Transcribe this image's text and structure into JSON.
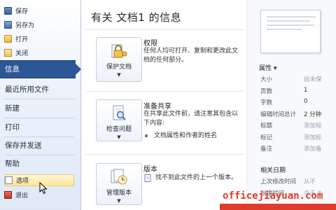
{
  "file_menu": {
    "items": [
      {
        "label": "保存",
        "icon": "save-icon"
      },
      {
        "label": "另存为",
        "icon": "save-as-icon"
      },
      {
        "label": "打开",
        "icon": "folder-open-icon"
      },
      {
        "label": "关闭",
        "icon": "close-document-icon"
      }
    ]
  },
  "nav": {
    "active": "信息",
    "items": [
      "最近所用文件",
      "新建",
      "打印",
      "保存并发送",
      "帮助"
    ]
  },
  "bottom_menu": {
    "options_label": "选项",
    "exit_label": "退出"
  },
  "page": {
    "title": "有关 文档1 的信息"
  },
  "sections": [
    {
      "button": "保护文档",
      "icon": "lock-key-icon",
      "title": "权限",
      "desc": "任何人均可打开、复制和更改此文档的任何部分。"
    },
    {
      "button": "检查问题",
      "icon": "inspect-document-icon",
      "title": "准备共享",
      "desc": "在共享此文件前，请注意其包含以下内容:",
      "bullets": [
        "文档属性和作者的姓名"
      ]
    },
    {
      "button": "管理版本",
      "icon": "versions-icon",
      "title": "版本",
      "desc": "找不到此文件的上一个版本。"
    }
  ],
  "properties": {
    "header": "属性 ▾",
    "rows": [
      {
        "key": "大小",
        "value": "尚未保",
        "muted": true
      },
      {
        "key": "页数",
        "value": "1",
        "muted": false
      },
      {
        "key": "字数",
        "value": "0",
        "muted": false
      },
      {
        "key": "编辑时间总计",
        "value": "2 分钟",
        "muted": false
      },
      {
        "key": "标题",
        "value": "添加标",
        "muted": true
      },
      {
        "key": "标记",
        "value": "添加标",
        "muted": true
      },
      {
        "key": "备注",
        "value": "添加备",
        "muted": true
      }
    ]
  },
  "related_dates": {
    "header": "相关日期",
    "rows": [
      {
        "key": "上次修改时间",
        "value": "从不"
      },
      {
        "key": "创建时间",
        "value": "今天 8:"
      }
    ]
  },
  "watermark": "officejiayuan.com",
  "colors": {
    "accent": "#2b5797",
    "watermark": "#e03c2b"
  }
}
